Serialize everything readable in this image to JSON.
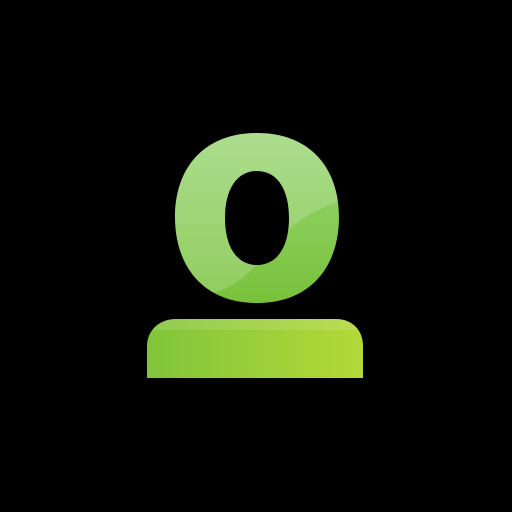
{
  "logo": {
    "name": "user-profile-icon",
    "glyph": "o",
    "colors": {
      "background": "#000000",
      "ring_top": "#9ad676",
      "ring_bottom": "#78c23a",
      "base_left": "#80c53a",
      "base_right": "#b4d838",
      "gloss": "#ffffff"
    }
  }
}
